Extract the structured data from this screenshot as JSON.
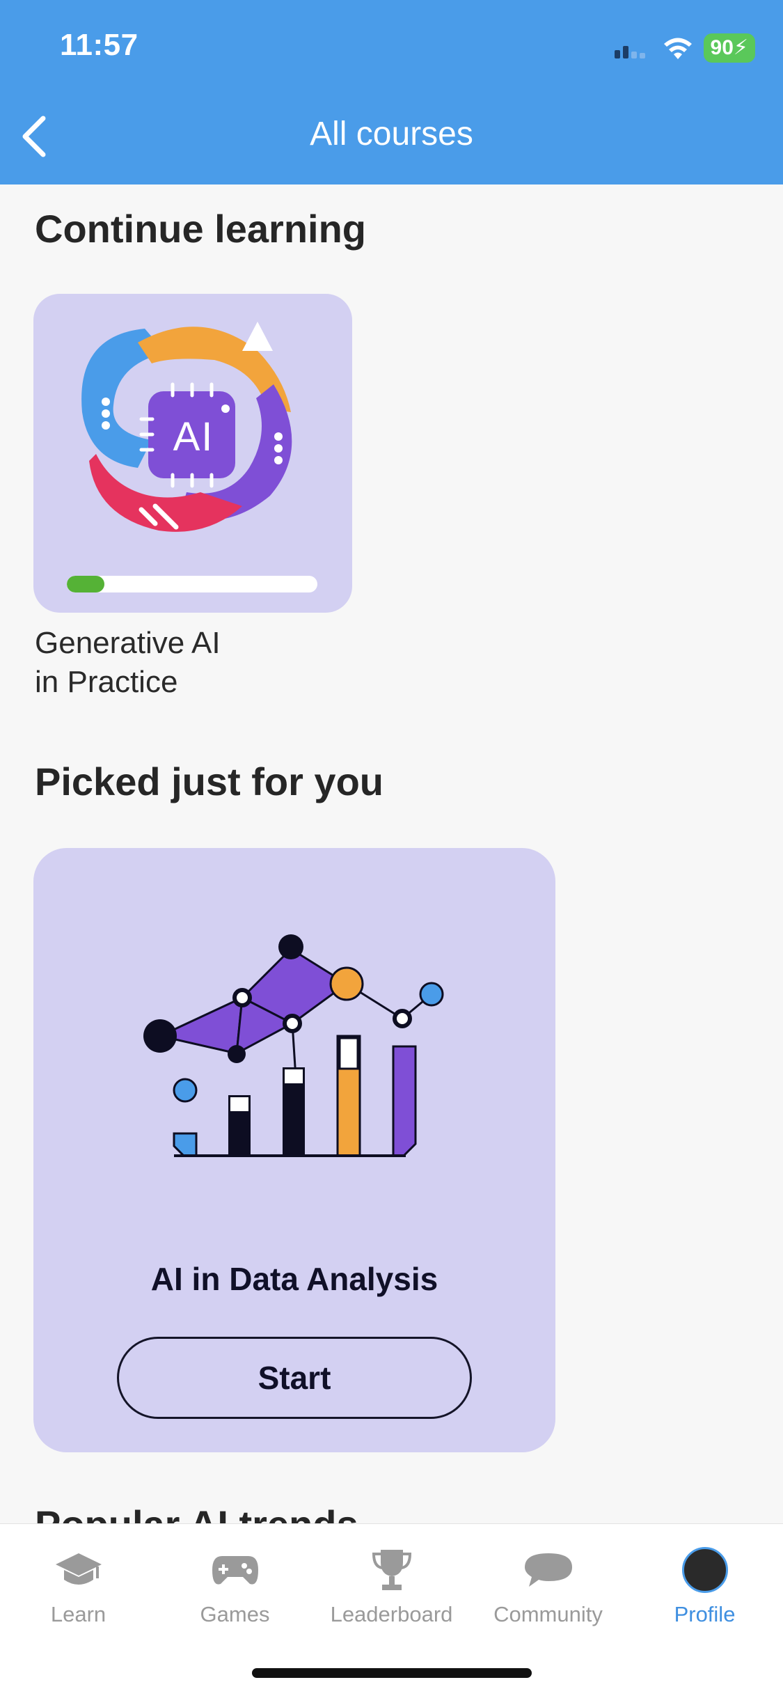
{
  "status_bar": {
    "time": "11:57",
    "battery": "90"
  },
  "header": {
    "title": "All courses"
  },
  "continue_section": {
    "title": "Continue learning",
    "course": {
      "name": "Generative AI\nin Practice",
      "progress": 0.15,
      "image_text": "AI"
    }
  },
  "picked_section": {
    "title": "Picked just for you",
    "course": {
      "name": "AI in Data Analysis",
      "button": "Start"
    }
  },
  "next_section": {
    "title_partial": "Popular AI trends"
  },
  "tabbar": {
    "items": [
      {
        "label": "Learn",
        "icon": "graduation-cap-icon"
      },
      {
        "label": "Games",
        "icon": "gamepad-icon"
      },
      {
        "label": "Leaderboard",
        "icon": "trophy-icon"
      },
      {
        "label": "Community",
        "icon": "chat-bubble-icon"
      },
      {
        "label": "Profile",
        "icon": "avatar",
        "active": true
      }
    ]
  },
  "colors": {
    "header": "#4a9ce9",
    "card": "#d3d0f2",
    "accent": "#3f8fe0",
    "progress": "#55b236"
  }
}
